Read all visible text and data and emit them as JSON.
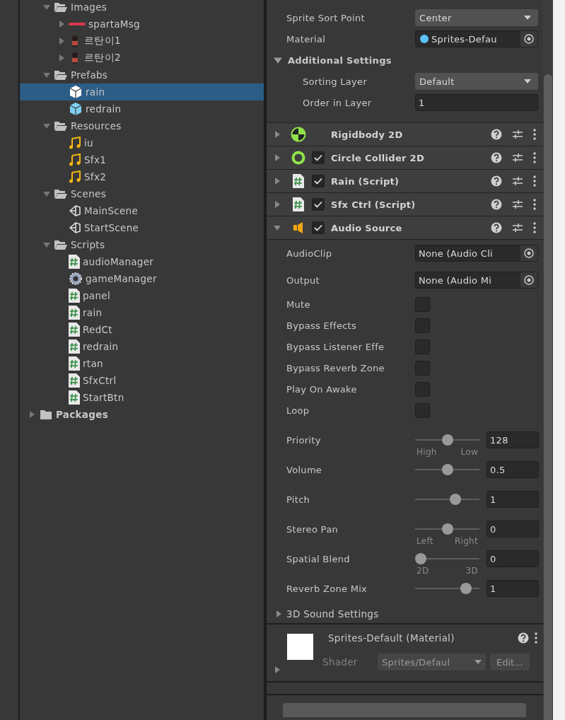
{
  "project": {
    "tree": [
      {
        "children": [
          {
            "label": "Images",
            "kind": "folder",
            "expanded": true,
            "selected": false,
            "children": [
              {
                "label": "spartaMsg",
                "kind": "banner",
                "expanded": false,
                "selected": false
              },
              {
                "label": "르탄이1",
                "kind": "figure",
                "expanded": false,
                "selected": false
              },
              {
                "label": "르탄이2",
                "kind": "figure",
                "expanded": false,
                "selected": false
              }
            ]
          },
          {
            "label": "Prefabs",
            "kind": "folder",
            "expanded": true,
            "selected": false,
            "children": [
              {
                "label": "rain",
                "kind": "prefab",
                "selected": true
              },
              {
                "label": "redrain",
                "kind": "prefab",
                "selected": false
              }
            ]
          },
          {
            "label": "Resources",
            "kind": "folder",
            "expanded": true,
            "selected": false,
            "children": [
              {
                "label": "iu",
                "kind": "audio",
                "selected": false
              },
              {
                "label": "Sfx1",
                "kind": "audio",
                "selected": false
              },
              {
                "label": "Sfx2",
                "kind": "audio",
                "selected": false
              }
            ]
          },
          {
            "label": "Scenes",
            "kind": "folder",
            "expanded": true,
            "selected": false,
            "children": [
              {
                "label": "MainScene",
                "kind": "scene",
                "selected": false
              },
              {
                "label": "StartScene",
                "kind": "scene",
                "selected": false
              }
            ]
          },
          {
            "label": "Scripts",
            "kind": "folder",
            "expanded": true,
            "selected": false,
            "children": [
              {
                "label": "audioManager",
                "kind": "script",
                "selected": false
              },
              {
                "label": "gameManager",
                "kind": "gear",
                "selected": false
              },
              {
                "label": "panel",
                "kind": "script",
                "selected": false
              },
              {
                "label": "rain",
                "kind": "script",
                "selected": false
              },
              {
                "label": "RedCt",
                "kind": "script",
                "selected": false
              },
              {
                "label": "redrain",
                "kind": "script",
                "selected": false
              },
              {
                "label": "rtan",
                "kind": "script",
                "selected": false
              },
              {
                "label": "SfxCtrl",
                "kind": "script",
                "selected": false
              },
              {
                "label": "StartBtn",
                "kind": "script",
                "selected": false
              }
            ]
          }
        ]
      },
      {
        "label": "Packages",
        "kind": "folder",
        "expanded": false,
        "selected": false
      }
    ]
  },
  "inspector": {
    "fields": [
      {
        "kind": "dropdown",
        "label": "Sprite Sort Point",
        "value": "Center"
      },
      {
        "kind": "asset",
        "label": "Material",
        "value": "Sprites-Defau"
      }
    ],
    "additional_settings": {
      "label": "Additional Settings",
      "expanded": true,
      "fields": [
        {
          "kind": "dropdown",
          "label": "Sorting Layer",
          "value": "Default"
        },
        {
          "kind": "number",
          "label": "Order in Layer",
          "value": "1"
        }
      ]
    },
    "components": [
      {
        "name": "Rigidbody 2D",
        "kind": "rigidbody",
        "expanded": false
      },
      {
        "name": "Circle Collider 2D",
        "kind": "collider",
        "checked": true,
        "expanded": false
      },
      {
        "name": "Rain (Script)",
        "kind": "script",
        "checked": true,
        "expanded": false
      },
      {
        "name": "Sfx Ctrl (Script)",
        "kind": "script",
        "checked": true,
        "expanded": false
      },
      {
        "name": "Audio Source",
        "kind": "audio",
        "checked": true,
        "expanded": true,
        "properties": [
          {
            "kind": "object",
            "label": "AudioClip",
            "value": "None (Audio Cli"
          },
          {
            "kind": "object",
            "label": "Output",
            "value": "None (Audio Mi"
          },
          {
            "kind": "checkbox",
            "label": "Mute",
            "checked": false
          },
          {
            "kind": "checkbox",
            "label": "Bypass Effects",
            "checked": false
          },
          {
            "kind": "checkbox",
            "label": "Bypass Listener Effe",
            "checked": false
          },
          {
            "kind": "checkbox",
            "label": "Bypass Reverb Zone",
            "checked": false
          },
          {
            "kind": "checkbox",
            "label": "Play On Awake",
            "checked": false
          },
          {
            "kind": "checkbox",
            "label": "Loop",
            "checked": false
          },
          {
            "kind": "slider",
            "label": "Priority",
            "level": 0.5,
            "value": "128",
            "min_label": "High",
            "max_label": "Low"
          },
          {
            "kind": "slider",
            "label": "Volume",
            "level": 0.5,
            "value": "0.5"
          },
          {
            "kind": "slider",
            "label": "Pitch",
            "level": 0.65,
            "value": "1"
          },
          {
            "kind": "slider",
            "label": "Stereo Pan",
            "level": 0.5,
            "value": "0",
            "min_label": "Left",
            "max_label": "Right"
          },
          {
            "kind": "slider",
            "label": "Spatial Blend",
            "level": 0,
            "value": "0",
            "min_label": "2D",
            "max_label": "3D"
          },
          {
            "kind": "slider",
            "label": "Reverb Zone Mix",
            "level": 0.85,
            "value": "1"
          }
        ],
        "sound_3d": {
          "label": "3D Sound Settings",
          "expanded": false
        }
      }
    ],
    "material": {
      "name": "Sprites-Default (Material)",
      "shader_label": "Shader",
      "shader": "Sprites/Defaul",
      "edit_button": "Edit...",
      "expanded": false
    }
  }
}
